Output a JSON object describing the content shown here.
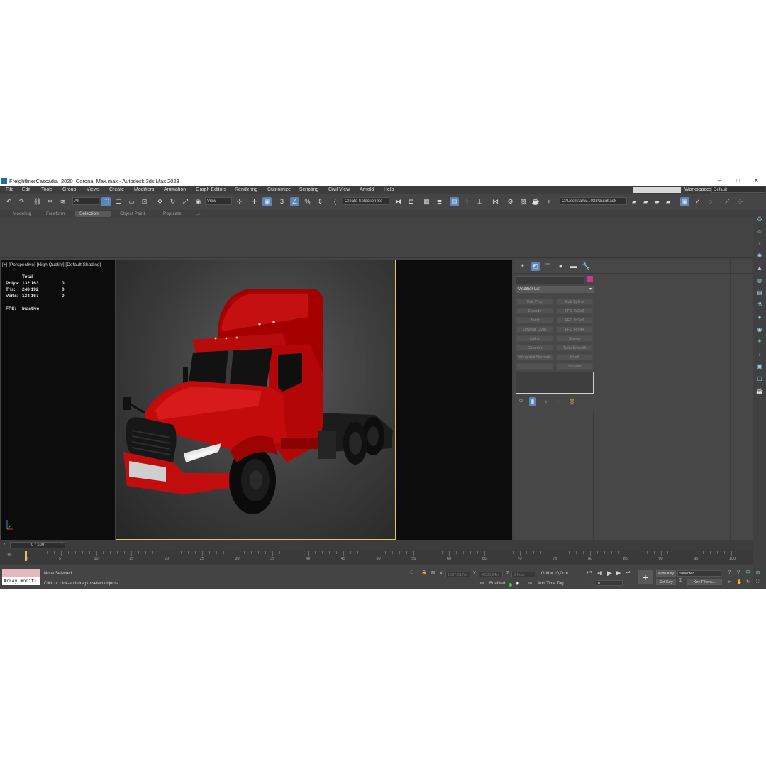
{
  "window": {
    "title": "FreightlinerCascadia_2020_Corona_Max.max - Autodesk 3ds Max 2023",
    "minimize": "–",
    "maximize": "□",
    "close": "✕"
  },
  "menu": [
    "File",
    "Edit",
    "Tools",
    "Group",
    "Views",
    "Create",
    "Modifiers",
    "Animation",
    "Graph Editors",
    "Rendering",
    "Customize",
    "Scripting",
    "Civil View",
    "Arnold",
    "Help"
  ],
  "workspace": {
    "label": "Workspaces:",
    "value": "Default"
  },
  "toolbar": {
    "filter": "All",
    "ref_coord": "View",
    "selection_set": "Create Selection Se",
    "path": "C:\\Users\\anw...023\\autoback"
  },
  "ribbon_tabs": [
    "Modeling",
    "Freeform",
    "Selection",
    "Object Paint",
    "Populate"
  ],
  "viewport": {
    "label": "[+] [Perspective] [High Quality] [Default Shading]",
    "stats": {
      "header": "Total",
      "rows": [
        {
          "label": "Polys:",
          "total": "132 163",
          "sel": "0"
        },
        {
          "label": "Tris:",
          "total": "240 192",
          "sel": "0"
        },
        {
          "label": "Verts:",
          "total": "134 167",
          "sel": "0"
        }
      ],
      "fps_label": "FPS:",
      "fps_value": "Inactive"
    }
  },
  "command_panel": {
    "modifier_list": "Modifier List",
    "buttons": [
      [
        "Edit Poly",
        "Edit Spline"
      ],
      [
        "Extrude",
        "FFD 2x2x2"
      ],
      [
        "Twist",
        "FFD 3x3x3"
      ],
      [
        "Unwrap UVW",
        "FFD 4x4x4"
      ],
      [
        "Lathe",
        "Sweep"
      ],
      [
        "Chamfer",
        "TurboSmooth"
      ],
      [
        "Weighted Normals",
        "Shell"
      ],
      [
        "",
        "Smooth"
      ]
    ]
  },
  "timeline": {
    "frame": "0 / 100",
    "ticks": [
      "0",
      "5",
      "10",
      "15",
      "20",
      "25",
      "30",
      "35",
      "40",
      "45",
      "50",
      "55",
      "60",
      "65",
      "70",
      "75",
      "80",
      "85",
      "90",
      "95",
      "100"
    ]
  },
  "status": {
    "maxscript": "Array modifi",
    "selection": "None Selected",
    "prompt": "Click or click-and-drag to select objects",
    "x_label": "X:",
    "x_value": "1087,617m",
    "y_label": "Y:",
    "y_value": "-4503,64m",
    "z_label": "Z:",
    "z_value": "0,0cm",
    "grid": "Grid = 10,0cm",
    "enabled": "Enabled:",
    "add_time_tag": "Add Time Tag",
    "auto_key": "Auto Key",
    "set_key": "Set Key",
    "key_mode": "Selected",
    "key_filters": "Key Filters...",
    "frame_field": "0"
  }
}
